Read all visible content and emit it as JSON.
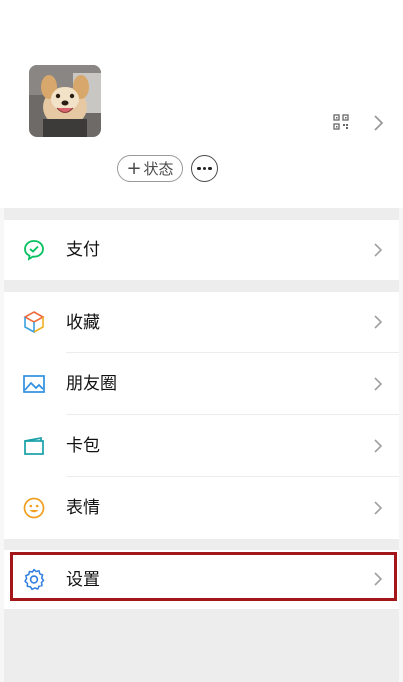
{
  "profile": {
    "status_plus": "+",
    "status_label": "状态"
  },
  "menu": {
    "pay": "支付",
    "favorites": "收藏",
    "moments": "朋友圈",
    "cards": "卡包",
    "stickers": "表情",
    "settings": "设置"
  },
  "colors": {
    "highlight_border": "#a3171a",
    "pay_green": "#07c160",
    "moments_blue": "#2f8fe0",
    "cards_teal": "#17a0a8",
    "sticker_yellow": "#f0a020",
    "settings_blue": "#2f7fe0"
  }
}
